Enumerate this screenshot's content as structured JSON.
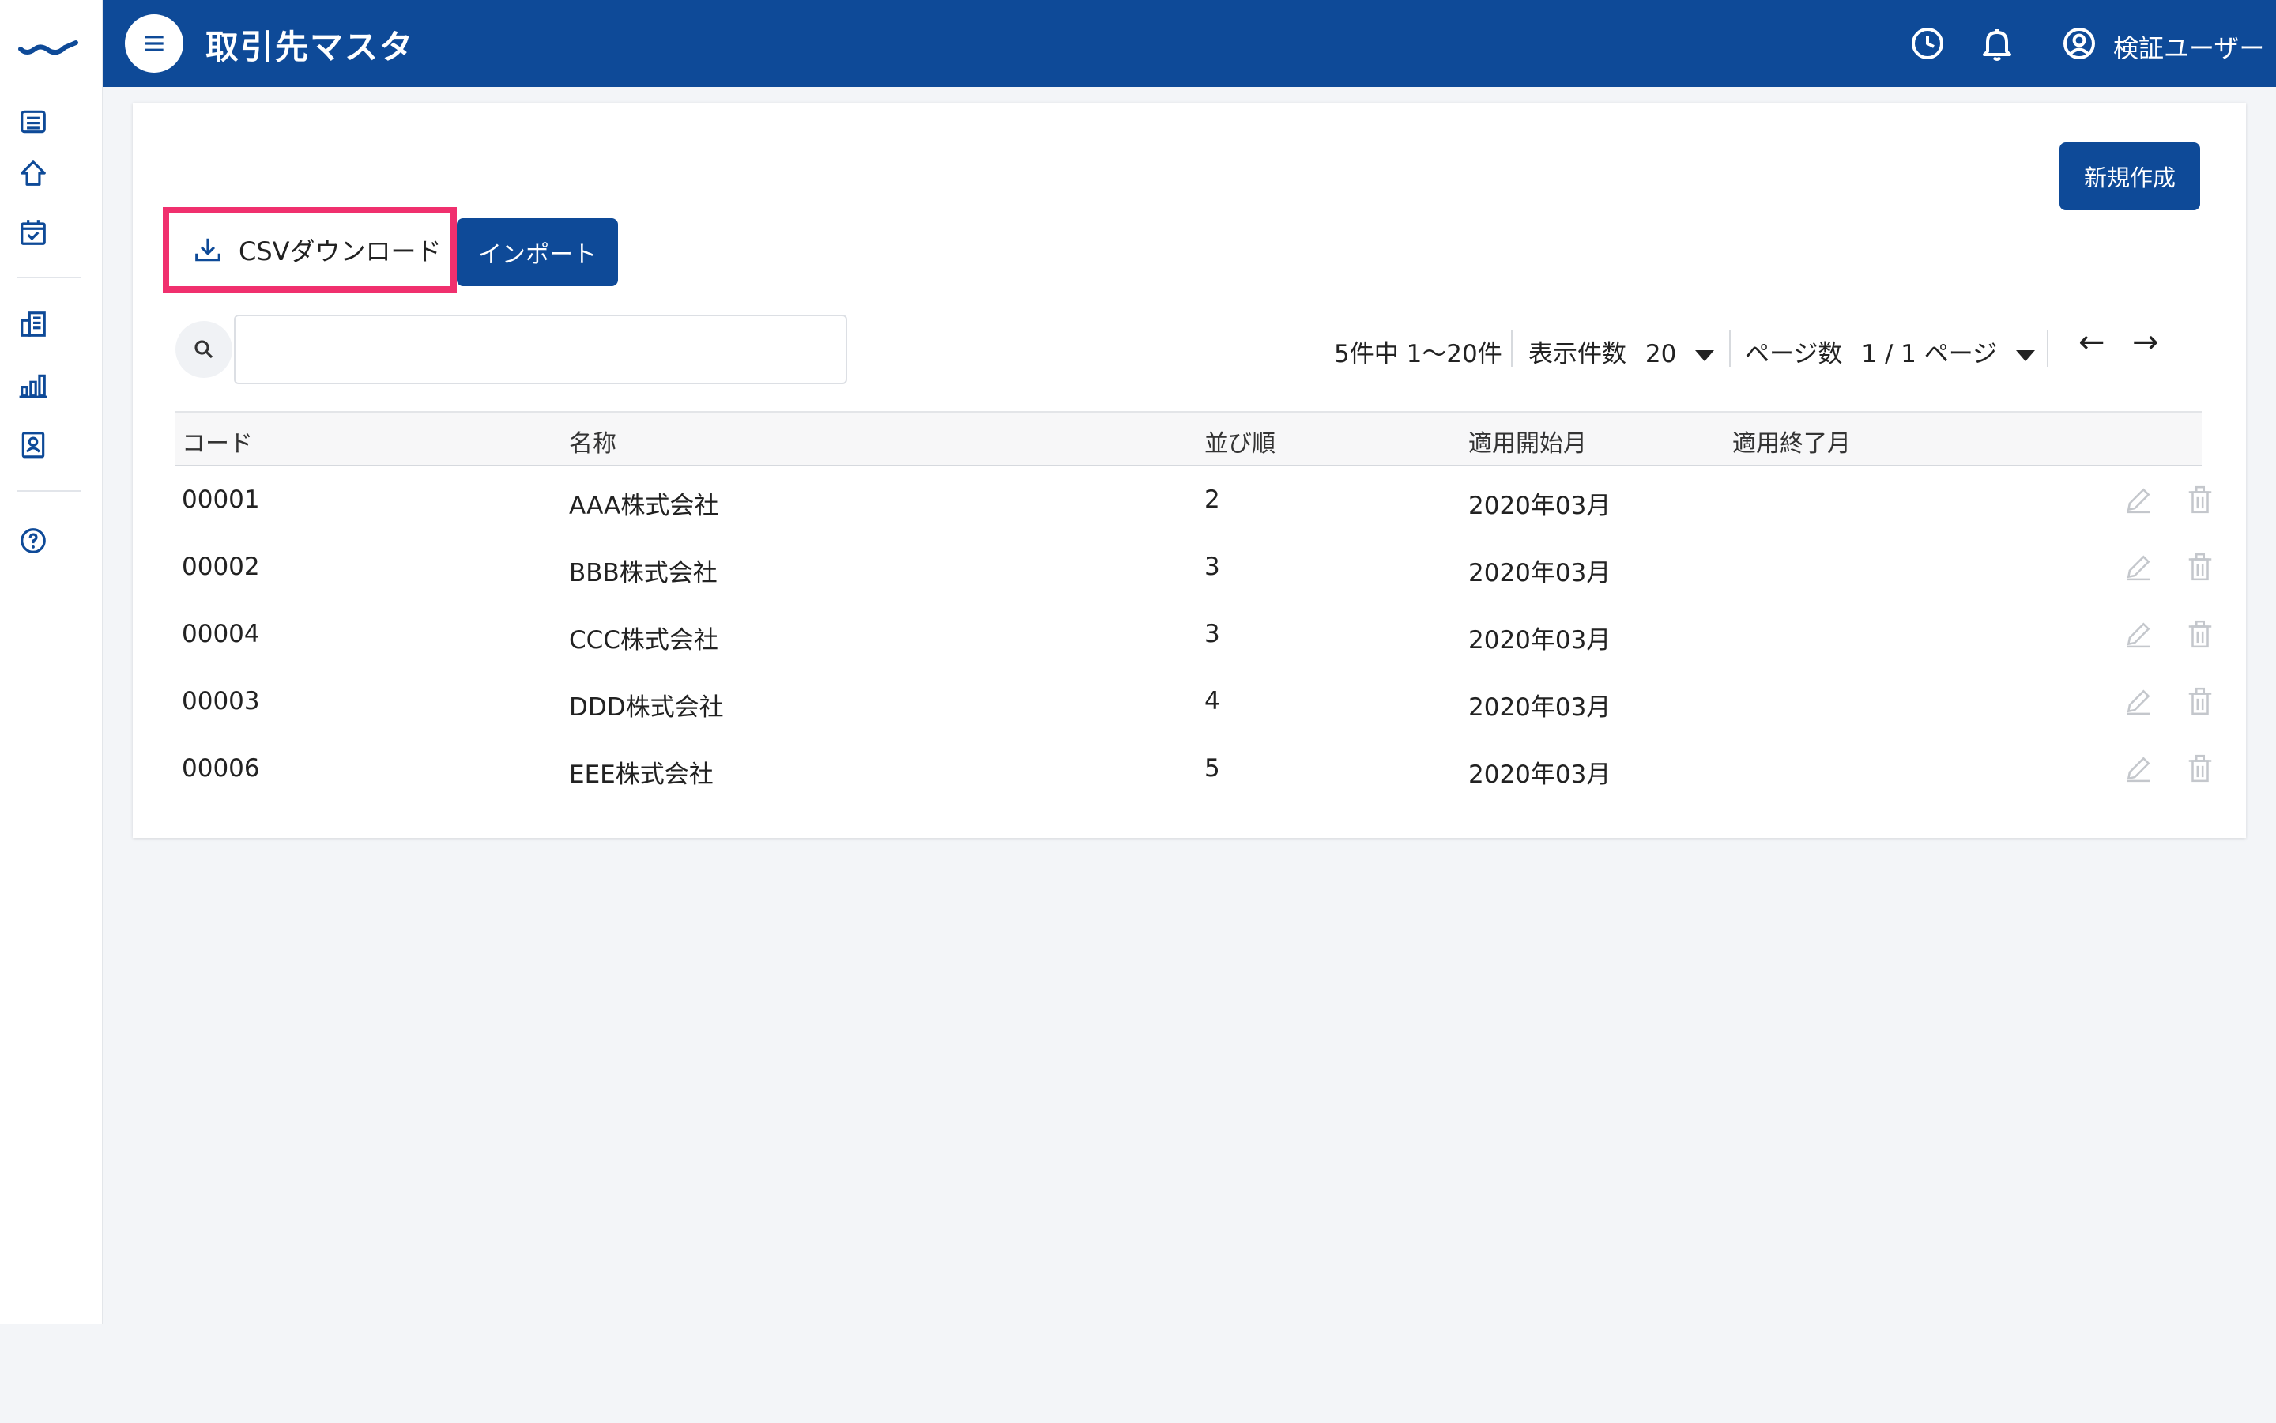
{
  "header": {
    "title": "取引先マスタ",
    "user_name": "検証ユーザー",
    "color": "#0e4a98"
  },
  "sidebar": {
    "items": [
      {
        "icon": "list-icon"
      },
      {
        "icon": "home-icon"
      },
      {
        "icon": "calendar-check-icon"
      },
      {
        "icon": "building-icon"
      },
      {
        "icon": "bar-chart-icon"
      },
      {
        "icon": "contact-card-icon"
      },
      {
        "icon": "help-icon"
      }
    ]
  },
  "toolbar": {
    "new_label": "新規作成",
    "csv_label": "CSVダウンロード",
    "import_label": "インポート",
    "highlight_color": "#f0306e"
  },
  "search": {
    "value": "",
    "placeholder": ""
  },
  "pager": {
    "summary": "5件中 1〜20件",
    "page_size_label": "表示件数",
    "page_size_value": "20",
    "page_label": "ページ数",
    "page_value": "1 / 1 ページ",
    "prev": "←",
    "next": "→"
  },
  "table": {
    "columns": [
      "コード",
      "名称",
      "並び順",
      "適用開始月",
      "適用終了月"
    ],
    "rows": [
      {
        "code": "00001",
        "name": "AAA株式会社",
        "order": "2",
        "start": "2020年03月",
        "end": ""
      },
      {
        "code": "00002",
        "name": "BBB株式会社",
        "order": "3",
        "start": "2020年03月",
        "end": ""
      },
      {
        "code": "00004",
        "name": "CCC株式会社",
        "order": "3",
        "start": "2020年03月",
        "end": ""
      },
      {
        "code": "00003",
        "name": "DDD株式会社",
        "order": "4",
        "start": "2020年03月",
        "end": ""
      },
      {
        "code": "00006",
        "name": "EEE株式会社",
        "order": "5",
        "start": "2020年03月",
        "end": ""
      }
    ]
  }
}
